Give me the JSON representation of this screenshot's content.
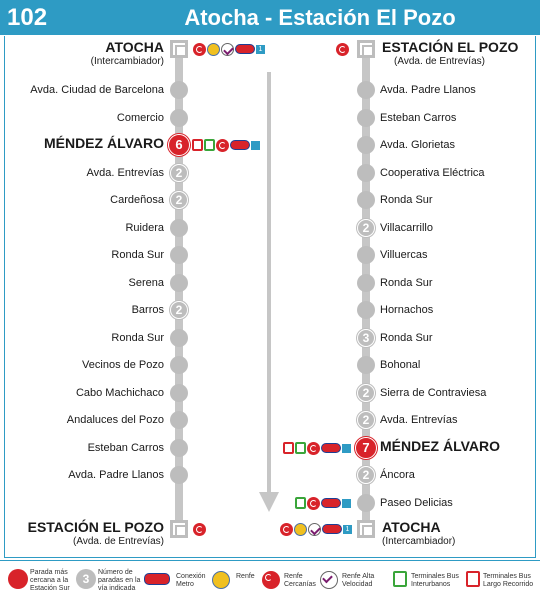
{
  "header": {
    "route_number": "102",
    "title": "Atocha - Estación El Pozo"
  },
  "left_column": {
    "origin": {
      "name": "ATOCHA",
      "sub": "(Intercambiador)"
    },
    "stops": [
      {
        "name": "Avda. Ciudad de Barcelona",
        "lines": ""
      },
      {
        "name": "Comercio",
        "lines": ""
      },
      {
        "name": "MÉNDEZ ÁLVARO",
        "lines": "6",
        "major": true
      },
      {
        "name": "Avda. Entrevías",
        "lines": "2"
      },
      {
        "name": "Cardeñosa",
        "lines": "2"
      },
      {
        "name": "Ruidera",
        "lines": ""
      },
      {
        "name": "Ronda Sur",
        "lines": ""
      },
      {
        "name": "Serena",
        "lines": ""
      },
      {
        "name": "Barros",
        "lines": "2"
      },
      {
        "name": "Ronda Sur",
        "lines": ""
      },
      {
        "name": "Vecinos de Pozo",
        "lines": ""
      },
      {
        "name": "Cabo Machichaco",
        "lines": ""
      },
      {
        "name": "Andaluces del Pozo",
        "lines": ""
      },
      {
        "name": "Esteban Carros",
        "lines": ""
      },
      {
        "name": "Avda. Padre Llanos",
        "lines": ""
      }
    ],
    "destination": {
      "name": "ESTACIÓN EL POZO",
      "sub": "(Avda. de Entrevías)"
    }
  },
  "right_column": {
    "origin": {
      "name": "ESTACIÓN EL POZO",
      "sub": "(Avda. de Entrevías)"
    },
    "stops": [
      {
        "name": "Avda. Padre Llanos",
        "lines": ""
      },
      {
        "name": "Esteban Carros",
        "lines": ""
      },
      {
        "name": "Avda. Glorietas",
        "lines": ""
      },
      {
        "name": "Cooperativa Eléctrica",
        "lines": ""
      },
      {
        "name": "Ronda Sur",
        "lines": ""
      },
      {
        "name": "Villacarrillo",
        "lines": "2"
      },
      {
        "name": "Villuercas",
        "lines": ""
      },
      {
        "name": "Ronda Sur",
        "lines": ""
      },
      {
        "name": "Hornachos",
        "lines": ""
      },
      {
        "name": "Ronda Sur",
        "lines": "3"
      },
      {
        "name": "Bohonal",
        "lines": ""
      },
      {
        "name": "Sierra de Contraviesa",
        "lines": "2"
      },
      {
        "name": "Avda. Entrevías",
        "lines": "2"
      },
      {
        "name": "MÉNDEZ ÁLVARO",
        "lines": "7",
        "major": true
      },
      {
        "name": "Áncora",
        "lines": "2"
      },
      {
        "name": "Paseo Delicias",
        "lines": ""
      }
    ],
    "destination": {
      "name": "ATOCHA",
      "sub": "(Intercambiador)"
    }
  },
  "legend": {
    "red_stop": "Parada más cercana a la Estación Sur",
    "grey_stop_num": "3",
    "grey_stop": "Número de paradas en la vía indicada",
    "metro": "Conexión Metro",
    "renfe": "Renfe",
    "cercanias": "Renfe Cercanías",
    "ave": "Renfe Alta Velocidad",
    "bus_inter": "Terminales Bus Interurbanos",
    "bus_largo": "Terminales Bus Largo Recorrido"
  },
  "colors": {
    "header": "#2e9bc4",
    "line": "#c6c6c6",
    "major_stop": "#d8232a"
  }
}
